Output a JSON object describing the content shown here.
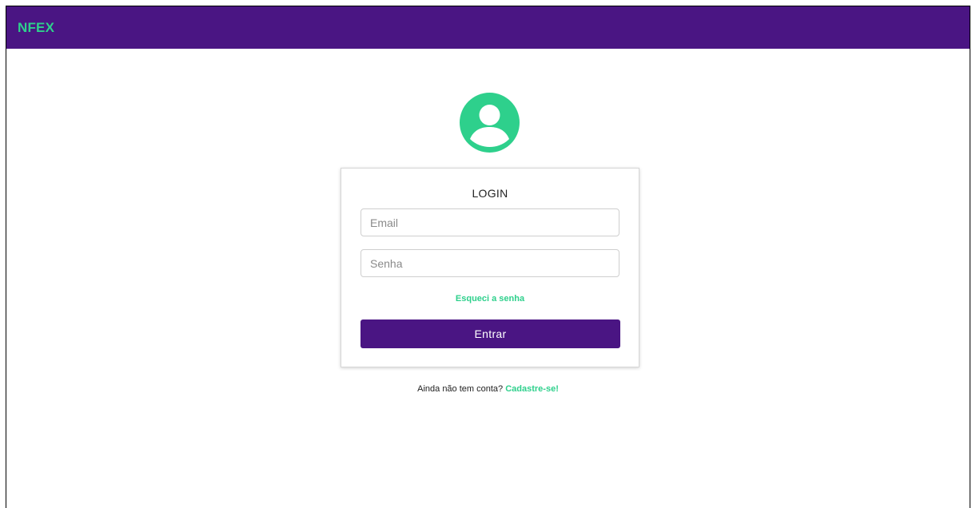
{
  "header": {
    "brand": "NFEX",
    "brand_color": "#2ed08c",
    "bar_color": "#4a1583"
  },
  "avatar": {
    "icon": "user-circle-icon",
    "color": "#2ed08c"
  },
  "login_card": {
    "title": "LOGIN",
    "email_placeholder": "Email",
    "password_placeholder": "Senha",
    "forgot_password_label": "Esqueci a senha",
    "submit_label": "Entrar"
  },
  "signup": {
    "prompt": "Ainda não tem conta?",
    "link_label": "Cadastre-se!"
  }
}
